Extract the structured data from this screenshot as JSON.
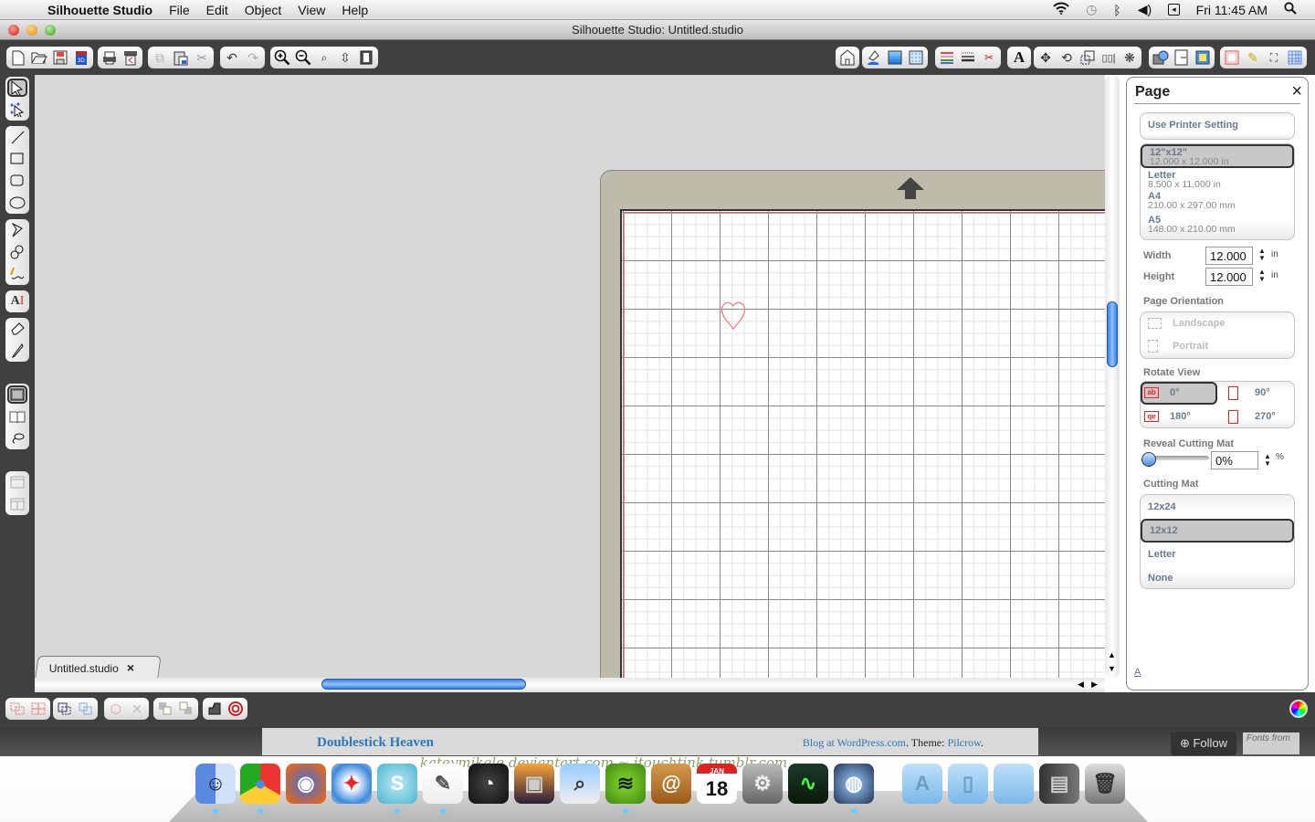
{
  "menubar": {
    "app_name": "Silhouette Studio",
    "menus": [
      "File",
      "Edit",
      "Object",
      "View",
      "Help"
    ],
    "clock": "Fri 11:45 AM",
    "status_icons": [
      "wifi-icon",
      "time-machine-icon",
      "bluetooth-icon",
      "volume-icon",
      "battery-icon",
      "spotlight-icon"
    ]
  },
  "window": {
    "title": "Silhouette Studio: Untitled.studio"
  },
  "toolbar": {
    "left_groups": [
      [
        "new-document",
        "open-document",
        "save-document",
        "save-to-sd"
      ],
      [
        "print",
        "print-cut"
      ],
      [
        "copy",
        "paste",
        "cut"
      ],
      [
        "undo",
        "redo"
      ],
      [
        "zoom-in",
        "zoom-out",
        "zoom-select",
        "pan",
        "fit-to-page"
      ]
    ],
    "right_groups": [
      [
        "store"
      ],
      [
        "fill-color",
        "fill-gradient",
        "fill-pattern"
      ],
      [
        "line-color",
        "line-style",
        "cut-style"
      ],
      [
        "text-style"
      ],
      [
        "transform",
        "rotate",
        "scale",
        "align",
        "replicate"
      ],
      [
        "offset",
        "trace",
        "registration-marks"
      ],
      [
        "page-settings",
        "sketch",
        "fullscreen",
        "grid"
      ]
    ]
  },
  "left_tools": {
    "groups": [
      [
        "select",
        "point-edit"
      ],
      [
        "line",
        "rectangle",
        "rounded-rectangle",
        "ellipse"
      ],
      [
        "polygon",
        "curve",
        "freehand"
      ],
      [
        "text"
      ],
      [
        "eraser",
        "knife"
      ],
      [
        "draw-mode",
        "library",
        "lasso"
      ],
      [
        "panel-layout-1",
        "panel-layout-2"
      ]
    ],
    "selected": "select"
  },
  "document_tab": {
    "label": "Untitled.studio",
    "close_label": "×"
  },
  "canvas": {
    "shape": "heart",
    "shape_color": "#f08080",
    "mat_color": "#bdbcab"
  },
  "page_panel": {
    "title": "Page",
    "close_label": "×",
    "use_printer_setting": "Use Printer Setting",
    "sizes": [
      {
        "name": "12\"x12\"",
        "dims": "12.000 x 12.000 in",
        "selected": true
      },
      {
        "name": "Letter",
        "dims": "8.500 x 11.000 in",
        "selected": false
      },
      {
        "name": "A4",
        "dims": "210.00 x 297.00 mm",
        "selected": false
      },
      {
        "name": "A5",
        "dims": "148.00 x 210.00 mm",
        "selected": false
      }
    ],
    "width_label": "Width",
    "width_value": "12.000",
    "height_label": "Height",
    "height_value": "12.000",
    "unit": "in",
    "orientation_label": "Page Orientation",
    "orientations": [
      "Landscape",
      "Portrait"
    ],
    "rotate_label": "Rotate View",
    "rotations": [
      {
        "label": "0°",
        "selected": true
      },
      {
        "label": "90°",
        "selected": false
      },
      {
        "label": "180°",
        "selected": false
      },
      {
        "label": "270°",
        "selected": false
      }
    ],
    "reveal_label": "Reveal Cutting Mat",
    "reveal_value": "0%",
    "reveal_percent": 0,
    "reveal_unit": "%",
    "cutting_mat_label": "Cutting Mat",
    "cutting_mats": [
      {
        "label": "12x24",
        "selected": false
      },
      {
        "label": "12x12",
        "selected": true
      },
      {
        "label": "Letter",
        "selected": false
      },
      {
        "label": "None",
        "selected": false
      }
    ],
    "footer_link": "A"
  },
  "bottom_toolbar": {
    "groups": [
      [
        "group",
        "ungroup"
      ],
      [
        "make-compound",
        "release-compound"
      ],
      [
        "weld",
        "delete"
      ],
      [
        "bring-to-front",
        "send-to-back"
      ],
      [
        "shape-tool",
        "target"
      ]
    ]
  },
  "blog": {
    "title": "Doublestick Heaven",
    "credit_link": "Blog at WordPress.com",
    "credit_mid": ". Theme: ",
    "theme_link": "Pilcrow",
    "credit_end": ".",
    "follow_label": "Follow",
    "fonts_from": "Fonts from"
  },
  "dock": {
    "apps": [
      "Finder",
      "Chrome",
      "Firefox",
      "Safari",
      "Silhouette",
      "TextEdit",
      "Dashboard",
      "iPhoto",
      "Preview",
      "Spotify",
      "Address Book",
      "iCal",
      "System Preferences",
      "Activity Monitor",
      "Network Utility",
      "Applications",
      "Documents",
      "Downloads",
      "Spotify Window",
      "Trash"
    ],
    "ical_month": "JAN",
    "ical_day": "18",
    "watermark": "kateymikele.deviantart.com ~ itouchtink.tumblr.com"
  }
}
